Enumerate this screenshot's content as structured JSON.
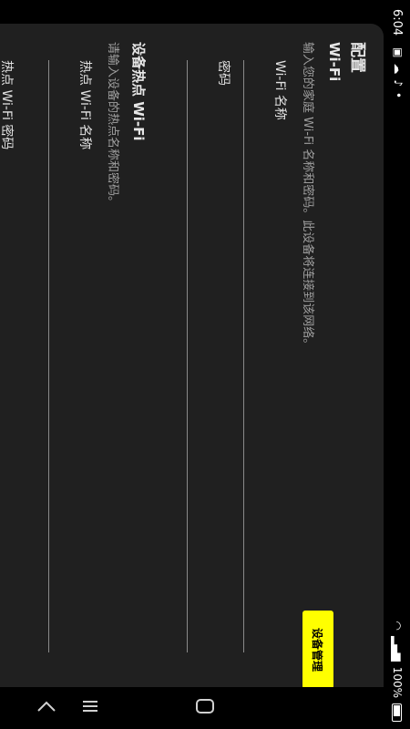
{
  "status": {
    "time": "6:04",
    "battery": "100%",
    "signal_icons": "wifi / signal"
  },
  "page": {
    "title": "配置",
    "wifi_section": {
      "title": "Wi-Fi",
      "description": "输入您的家庭 Wi-Fi 名称和密码。此设备将连接到该网络。",
      "fields": [
        {
          "label": "Wi-Fi 名称"
        },
        {
          "label": "密码"
        }
      ]
    },
    "hotspot_section": {
      "title": "设备热点 Wi-Fi",
      "description": "请输入设备的热点名称和密码。",
      "fields": [
        {
          "label": "热点 Wi-Fi 名称"
        },
        {
          "label": "热点 Wi-Fi 密码"
        }
      ]
    },
    "device_manage_button": "设备管理"
  },
  "colors": {
    "panel_bg": "#202020",
    "accent_button": "#ffff00",
    "background": "#000000"
  },
  "icons": {
    "nav_recent": "recent-apps-icon",
    "nav_home": "home-icon",
    "nav_back": "back-icon"
  }
}
